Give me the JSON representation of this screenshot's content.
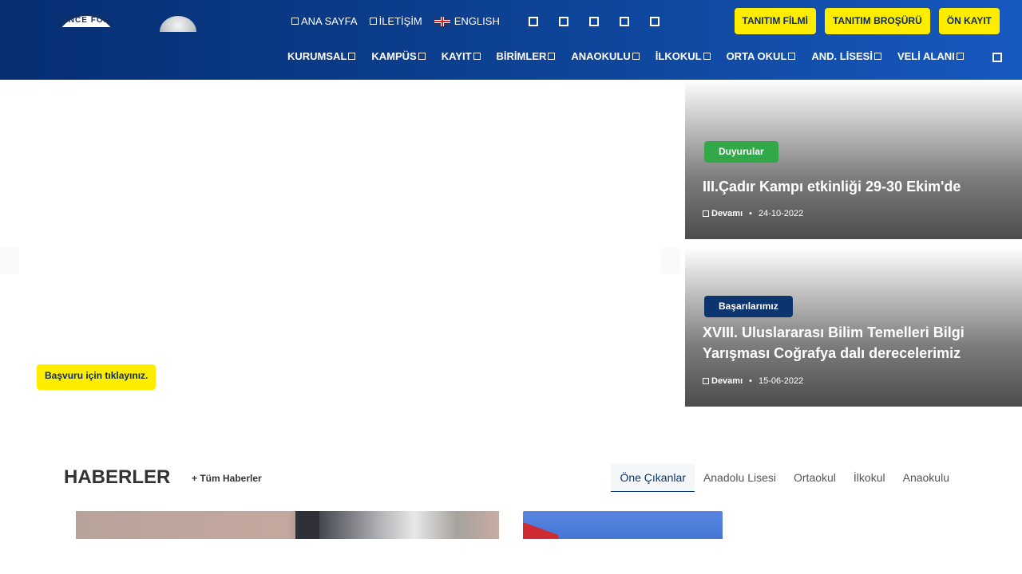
{
  "header": {
    "logo_text": "ENCE FOR",
    "top_links": [
      {
        "label": "ANA SAYFA",
        "icon": "home-icon"
      },
      {
        "label": "İLETİŞİM",
        "icon": "contact-icon"
      },
      {
        "label": "ENGLISH",
        "icon": "uk-flag-icon"
      }
    ],
    "social_icons": [
      "facebook-icon",
      "twitter-icon",
      "instagram-icon",
      "youtube-icon",
      "linkedin-icon"
    ],
    "cta_buttons": [
      "TANITIM FİLMİ",
      "TANITIM BROŞÜRÜ",
      "ÖN KAYIT"
    ],
    "nav": [
      "KURUMSAL",
      "KAMPÜS",
      "KAYIT",
      "BİRİMLER",
      "ANAOKULU",
      "İLKOKUL",
      "ORTA OKUL",
      "AND. LİSESİ",
      "VELİ ALANI"
    ],
    "colors": {
      "header_from": "#062e72",
      "header_to": "#1659bf",
      "accent_yellow": "#ffed00"
    }
  },
  "hero": {
    "apply_button": "Başvuru için tıklayınız.",
    "cards": [
      {
        "badge": "Duyurular",
        "badge_color": "#33a848",
        "title": "III.Çadır Kampı etkinliği 29-30 Ekim'de",
        "more": "Devamı",
        "date": "24-10-2022"
      },
      {
        "badge": "Başarılarımız",
        "badge_color": "#0c346e",
        "title": "XVIII. Uluslararası Bilim Temelleri Bilgi Yarışması Coğrafya dalı derecelerimiz",
        "more": "Devamı",
        "date": "15-06-2022"
      }
    ]
  },
  "news": {
    "title": "HABERLER",
    "all_link": "+ Tüm Haberler",
    "tabs": [
      "Öne Çıkanlar",
      "Anadolu Lisesi",
      "Ortaokul",
      "İlkokul",
      "Anaokulu"
    ],
    "active_tab": "Öne Çıkanlar"
  }
}
